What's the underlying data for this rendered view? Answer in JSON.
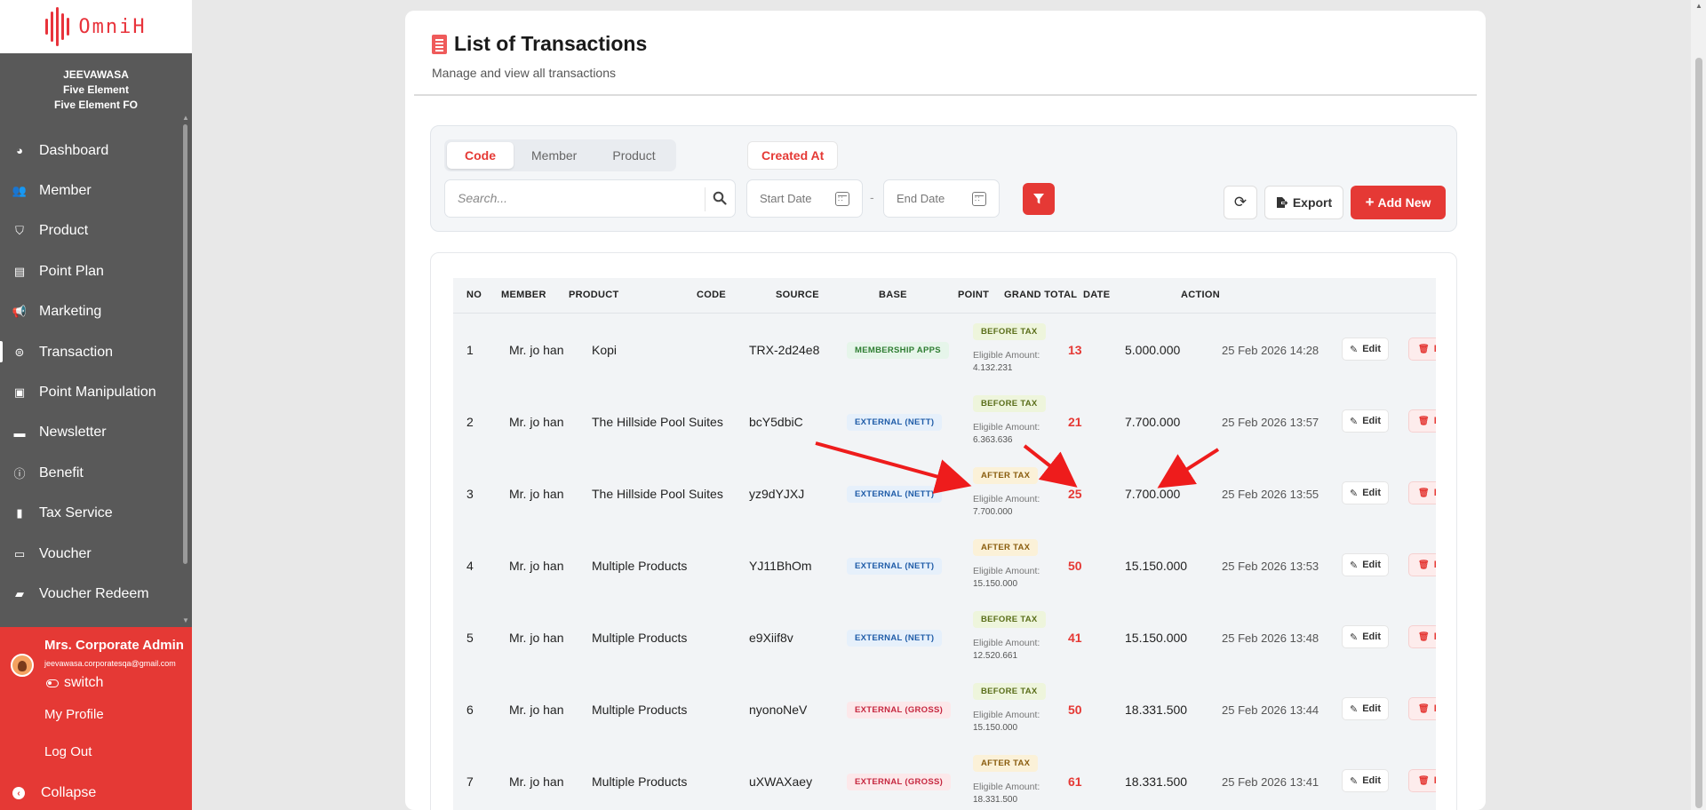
{
  "app": {
    "logo_text": "OmniH"
  },
  "org": {
    "line1": "JEEVAWASA",
    "line2": "Five Element",
    "line3": "Five Element FO"
  },
  "sidebar": {
    "items": [
      {
        "label": "Dashboard",
        "icon": "dashboard-icon"
      },
      {
        "label": "Member",
        "icon": "users-icon"
      },
      {
        "label": "Product",
        "icon": "basket-icon"
      },
      {
        "label": "Point Plan",
        "icon": "point-plan-icon"
      },
      {
        "label": "Marketing",
        "icon": "megaphone-icon"
      },
      {
        "label": "Transaction",
        "icon": "transaction-icon",
        "active": true
      },
      {
        "label": "Point Manipulation",
        "icon": "money-icon"
      },
      {
        "label": "Newsletter",
        "icon": "newsletter-icon"
      },
      {
        "label": "Benefit",
        "icon": "info-icon"
      },
      {
        "label": "Tax Service",
        "icon": "document-icon"
      },
      {
        "label": "Voucher",
        "icon": "voucher-icon"
      },
      {
        "label": "Voucher Redeem",
        "icon": "ticket-icon"
      }
    ]
  },
  "user": {
    "name": "Mrs. Corporate Admin",
    "email": "jeevawasa.corporatesqa@gmail.com",
    "switch_label": "switch",
    "profile_label": "My Profile",
    "logout_label": "Log Out",
    "collapse_label": "Collapse"
  },
  "page": {
    "title": "List of Transactions",
    "subtitle": "Manage and view all transactions"
  },
  "filters": {
    "tabs": [
      "Code",
      "Member",
      "Product"
    ],
    "active_tab": "Code",
    "created_at_label": "Created At",
    "search_placeholder": "Search...",
    "start_date_placeholder": "Start Date",
    "end_date_placeholder": "End Date",
    "date_separator": "-",
    "export_label": "Export",
    "add_label": "Add New"
  },
  "table": {
    "columns": [
      "NO",
      "MEMBER",
      "PRODUCT",
      "CODE",
      "SOURCE",
      "BASE",
      "POINT",
      "GRAND TOTAL",
      "DATE",
      "ACTION"
    ],
    "eligible_label": "Eligible Amount:",
    "edit_label": "Edit",
    "delete_label": "D",
    "rows": [
      {
        "no": "1",
        "member": "Mr. jo han",
        "product": "Kopi",
        "code": "TRX-2d24e8",
        "source": "MEMBERSHIP APPS",
        "source_type": "membership",
        "base": "BEFORE TAX",
        "base_type": "before",
        "eligible": "4.132.231",
        "point": "13",
        "grand_total": "5.000.000",
        "date": "25 Feb 2026 14:28"
      },
      {
        "no": "2",
        "member": "Mr. jo han",
        "product": "The Hillside Pool Suites",
        "code": "bcY5dbiC",
        "source": "EXTERNAL (NETT)",
        "source_type": "nett",
        "base": "BEFORE TAX",
        "base_type": "before",
        "eligible": "6.363.636",
        "point": "21",
        "grand_total": "7.700.000",
        "date": "25 Feb 2026 13:57"
      },
      {
        "no": "3",
        "member": "Mr. jo han",
        "product": "The Hillside Pool Suites",
        "code": "yz9dYJXJ",
        "source": "EXTERNAL (NETT)",
        "source_type": "nett",
        "base": "AFTER TAX",
        "base_type": "after",
        "eligible": "7.700.000",
        "point": "25",
        "grand_total": "7.700.000",
        "date": "25 Feb 2026 13:55"
      },
      {
        "no": "4",
        "member": "Mr. jo han",
        "product": "Multiple Products",
        "code": "YJ11BhOm",
        "source": "EXTERNAL (NETT)",
        "source_type": "nett",
        "base": "AFTER TAX",
        "base_type": "after",
        "eligible": "15.150.000",
        "point": "50",
        "grand_total": "15.150.000",
        "date": "25 Feb 2026 13:53"
      },
      {
        "no": "5",
        "member": "Mr. jo han",
        "product": "Multiple Products",
        "code": "e9Xiif8v",
        "source": "EXTERNAL (NETT)",
        "source_type": "nett",
        "base": "BEFORE TAX",
        "base_type": "before",
        "eligible": "12.520.661",
        "point": "41",
        "grand_total": "15.150.000",
        "date": "25 Feb 2026 13:48"
      },
      {
        "no": "6",
        "member": "Mr. jo han",
        "product": "Multiple Products",
        "code": "nyonoNeV",
        "source": "EXTERNAL (GROSS)",
        "source_type": "gross",
        "base": "BEFORE TAX",
        "base_type": "before",
        "eligible": "15.150.000",
        "point": "50",
        "grand_total": "18.331.500",
        "date": "25 Feb 2026 13:44"
      },
      {
        "no": "7",
        "member": "Mr. jo han",
        "product": "Multiple Products",
        "code": "uXWAXaey",
        "source": "EXTERNAL (GROSS)",
        "source_type": "gross",
        "base": "AFTER TAX",
        "base_type": "after",
        "eligible": "18.331.500",
        "point": "61",
        "grand_total": "18.331.500",
        "date": "25 Feb 2026 13:41"
      }
    ]
  },
  "colors": {
    "brand": "#e53935",
    "sidebar_bg": "#595959",
    "annotation_arrow": "#ee1c1c"
  }
}
